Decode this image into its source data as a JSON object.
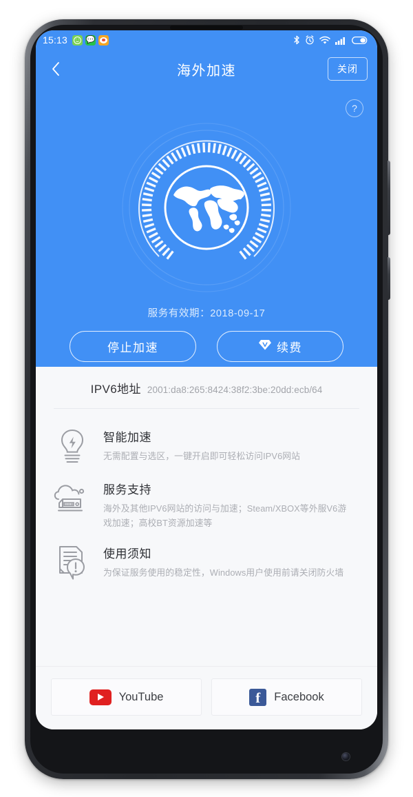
{
  "status_bar": {
    "time": "15:13",
    "app_icons": [
      {
        "name": "smiley-notification-icon",
        "label": "☺"
      },
      {
        "name": "wechat-notification-icon",
        "label": "✉"
      },
      {
        "name": "weibo-notification-icon",
        "label": "◉"
      }
    ],
    "system_icons": [
      "bluetooth-icon",
      "alarm-icon",
      "wifi-icon",
      "signal-icon",
      "battery-icon"
    ]
  },
  "app_bar": {
    "back_icon": "chevron-left-icon",
    "title": "海外加速",
    "close_label": "关闭"
  },
  "hero": {
    "help_label": "?",
    "globe_icon": "globe-icon",
    "validity_text": "服务有效期：2018-09-17",
    "stop_label": "停止加速",
    "renew_label": "续费",
    "renew_icon": "vip-diamond-icon",
    "accent_color": "#4190f5"
  },
  "ipv6": {
    "label": "IPV6地址",
    "value": "2001:da8:265:8424:38f2:3be:20dd:ecb/64"
  },
  "features": [
    {
      "icon": "lightbulb-icon",
      "title": "智能加速",
      "desc": "无需配置与选区，一键开启即可轻松访问IPV6网站"
    },
    {
      "icon": "cloud-server-icon",
      "title": "服务支持",
      "desc": "海外及其他IPV6网站的访问与加速；Steam/XBOX等外服V6游戏加速；高校BT资源加速等"
    },
    {
      "icon": "document-alert-icon",
      "title": "使用须知",
      "desc": "为保证服务使用的稳定性，Windows用户使用前请关闭防火墙"
    }
  ],
  "social": [
    {
      "icon": "youtube-icon",
      "label": "YouTube",
      "color": "#e02020"
    },
    {
      "icon": "facebook-icon",
      "label": "Facebook",
      "color": "#3b5998"
    }
  ]
}
